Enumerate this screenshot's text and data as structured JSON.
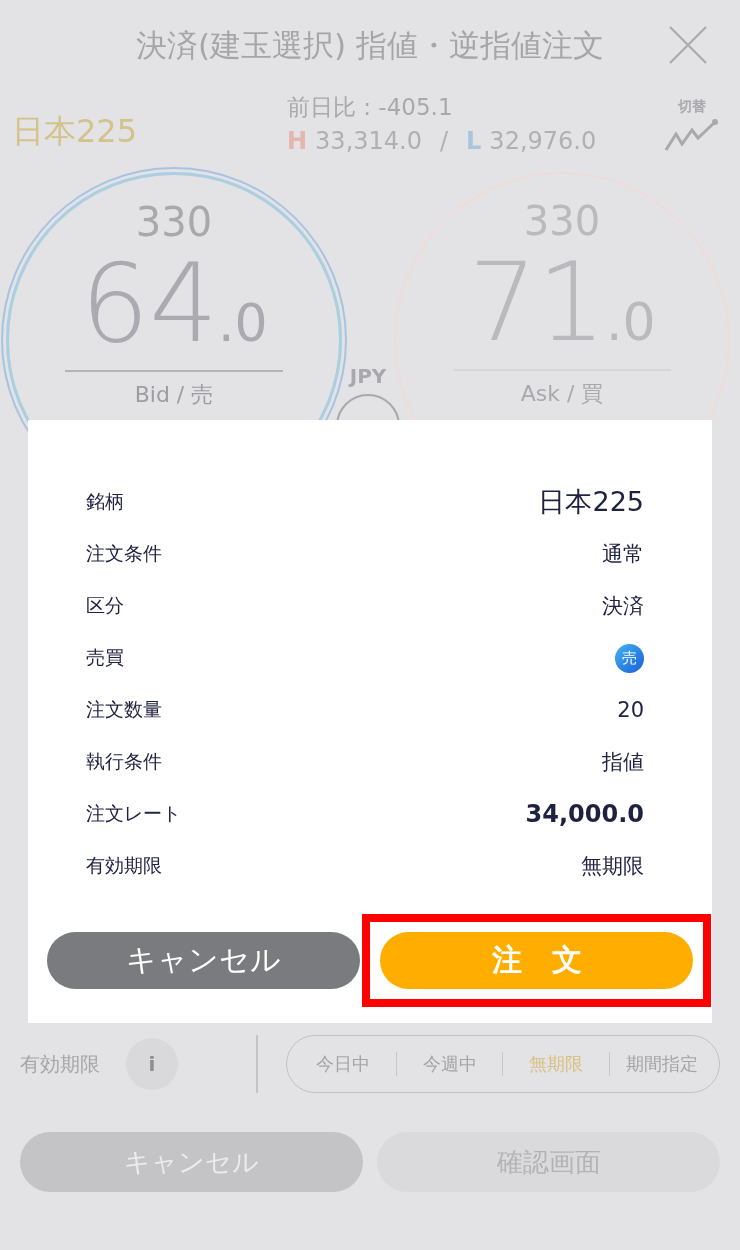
{
  "header": {
    "title": "決済(建玉選択) 指値・逆指値注文"
  },
  "quote": {
    "symbol": "日本225",
    "change": "前日比 : -405.1",
    "high_label": "H",
    "high": "33,314.0",
    "separator": "/",
    "low_label": "L",
    "low": "32,976.0",
    "switch_label": "切替"
  },
  "bid": {
    "prefix": "330",
    "big": "64",
    "small": ".0",
    "label": "Bid / 売"
  },
  "currency": "JPY",
  "ask": {
    "prefix": "330",
    "big": "71",
    "small": ".0",
    "label": "Ask / 買"
  },
  "expiry": {
    "label": "有効期限",
    "info": "i",
    "options": [
      {
        "label": "今日中",
        "selected": false
      },
      {
        "label": "今週中",
        "selected": false
      },
      {
        "label": "無期限",
        "selected": true
      },
      {
        "label": "期間指定",
        "selected": false
      }
    ]
  },
  "footer_buttons": [
    {
      "label": "キャンセル",
      "kind": "cancel"
    },
    {
      "label": "確認画面",
      "kind": "confirm"
    }
  ],
  "dialog": {
    "rows": [
      {
        "label": "銘柄",
        "value": "日本225",
        "kind": "large"
      },
      {
        "label": "注文条件",
        "value": "通常",
        "kind": "text"
      },
      {
        "label": "区分",
        "value": "決済",
        "kind": "text"
      },
      {
        "label": "売買",
        "value": "売",
        "kind": "badge"
      },
      {
        "label": "注文数量",
        "value": "20",
        "kind": "text"
      },
      {
        "label": "執行条件",
        "value": "指値",
        "kind": "text"
      },
      {
        "label": "注文レート",
        "value": "34,000.0",
        "kind": "rate"
      },
      {
        "label": "有効期限",
        "value": "無期限",
        "kind": "text"
      }
    ],
    "buttons": [
      {
        "label": "キャンセル",
        "kind": "cancel",
        "highlighted": false
      },
      {
        "label": "注　文",
        "kind": "primary",
        "highlighted": true
      }
    ]
  }
}
